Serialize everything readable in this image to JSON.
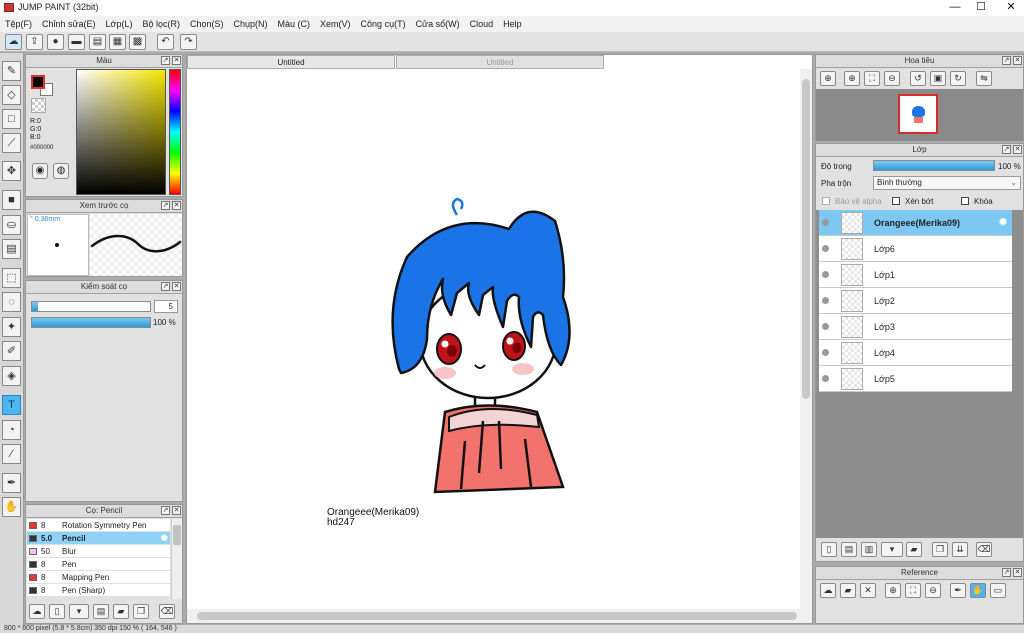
{
  "app": {
    "title": "JUMP PAINT (32bit)"
  },
  "window_controls": {
    "minimize": "—",
    "maximize": "☐",
    "close": "✕"
  },
  "menu": [
    "Tệp(F)",
    "Chỉnh sửa(E)",
    "Lớp(L)",
    "Bộ lọc(R)",
    "Chọn(S)",
    "Chụp(N)",
    "Màu (C)",
    "Xem(V)",
    "Công cụ(T)",
    "Cửa sổ(W)",
    "Cloud",
    "Help"
  ],
  "toolbar": {
    "undo": "↶",
    "redo": "↷"
  },
  "color_panel": {
    "title": "Màu",
    "foreground": "#000000",
    "background": "#ffffff",
    "r": "R:0",
    "g": "G:0",
    "b": "B:0",
    "hex": "#000000"
  },
  "brush_preview": {
    "title": "Xem trước cọ",
    "size": "° 0.36mm"
  },
  "brush_control": {
    "title": "Kiểm soát cọ",
    "size_value": "5",
    "opacity_value": "100 %",
    "size_fraction": 0.05,
    "opacity_fraction": 1.0
  },
  "brush_list": {
    "title": "Cọ: Pencil",
    "items": [
      {
        "size": "8",
        "name": "Rotation Symmetry Pen",
        "color": "#e53935"
      },
      {
        "size": "5.0",
        "name": "Pencil",
        "color": "#333333",
        "selected": true
      },
      {
        "size": "50",
        "name": "Blur",
        "color": "#f3c1f5"
      },
      {
        "size": "8",
        "name": "Pen",
        "color": "#333333"
      },
      {
        "size": "8",
        "name": "Mapping Pen",
        "color": "#e53935"
      },
      {
        "size": "8",
        "name": "Pen (Sharp)",
        "color": "#333333"
      }
    ]
  },
  "documents": {
    "tabs": [
      "Untitled",
      "Untitled"
    ]
  },
  "canvas": {
    "signature_line1": "Orangeee(Merika09)",
    "signature_line2": "hd247",
    "hair_color": "#1a74e8",
    "shirt_color": "#f2726e"
  },
  "navigator": {
    "title": "Hoa tiêu"
  },
  "layers": {
    "title": "Lớp",
    "opacity_label": "Độ trong",
    "opacity_value": "100 %",
    "opacity_fraction": 1.0,
    "blend_label": "Pha trộn",
    "blend_value": "Bình thường",
    "protect_alpha": "Bảo vệ alpha",
    "clipping": "Xén bớt",
    "lock": "Khóa",
    "items": [
      {
        "name": "Orangeee(Merika09)",
        "selected": true
      },
      {
        "name": "Lớp6"
      },
      {
        "name": "Lớp1"
      },
      {
        "name": "Lớp2"
      },
      {
        "name": "Lớp3"
      },
      {
        "name": "Lớp4"
      },
      {
        "name": "Lớp5"
      }
    ]
  },
  "reference": {
    "title": "Reference"
  },
  "status": {
    "text": "800 * 800 pixel   (5.8 * 5.8cm)   350 dpi   150 %   ( 164, 546 )"
  }
}
